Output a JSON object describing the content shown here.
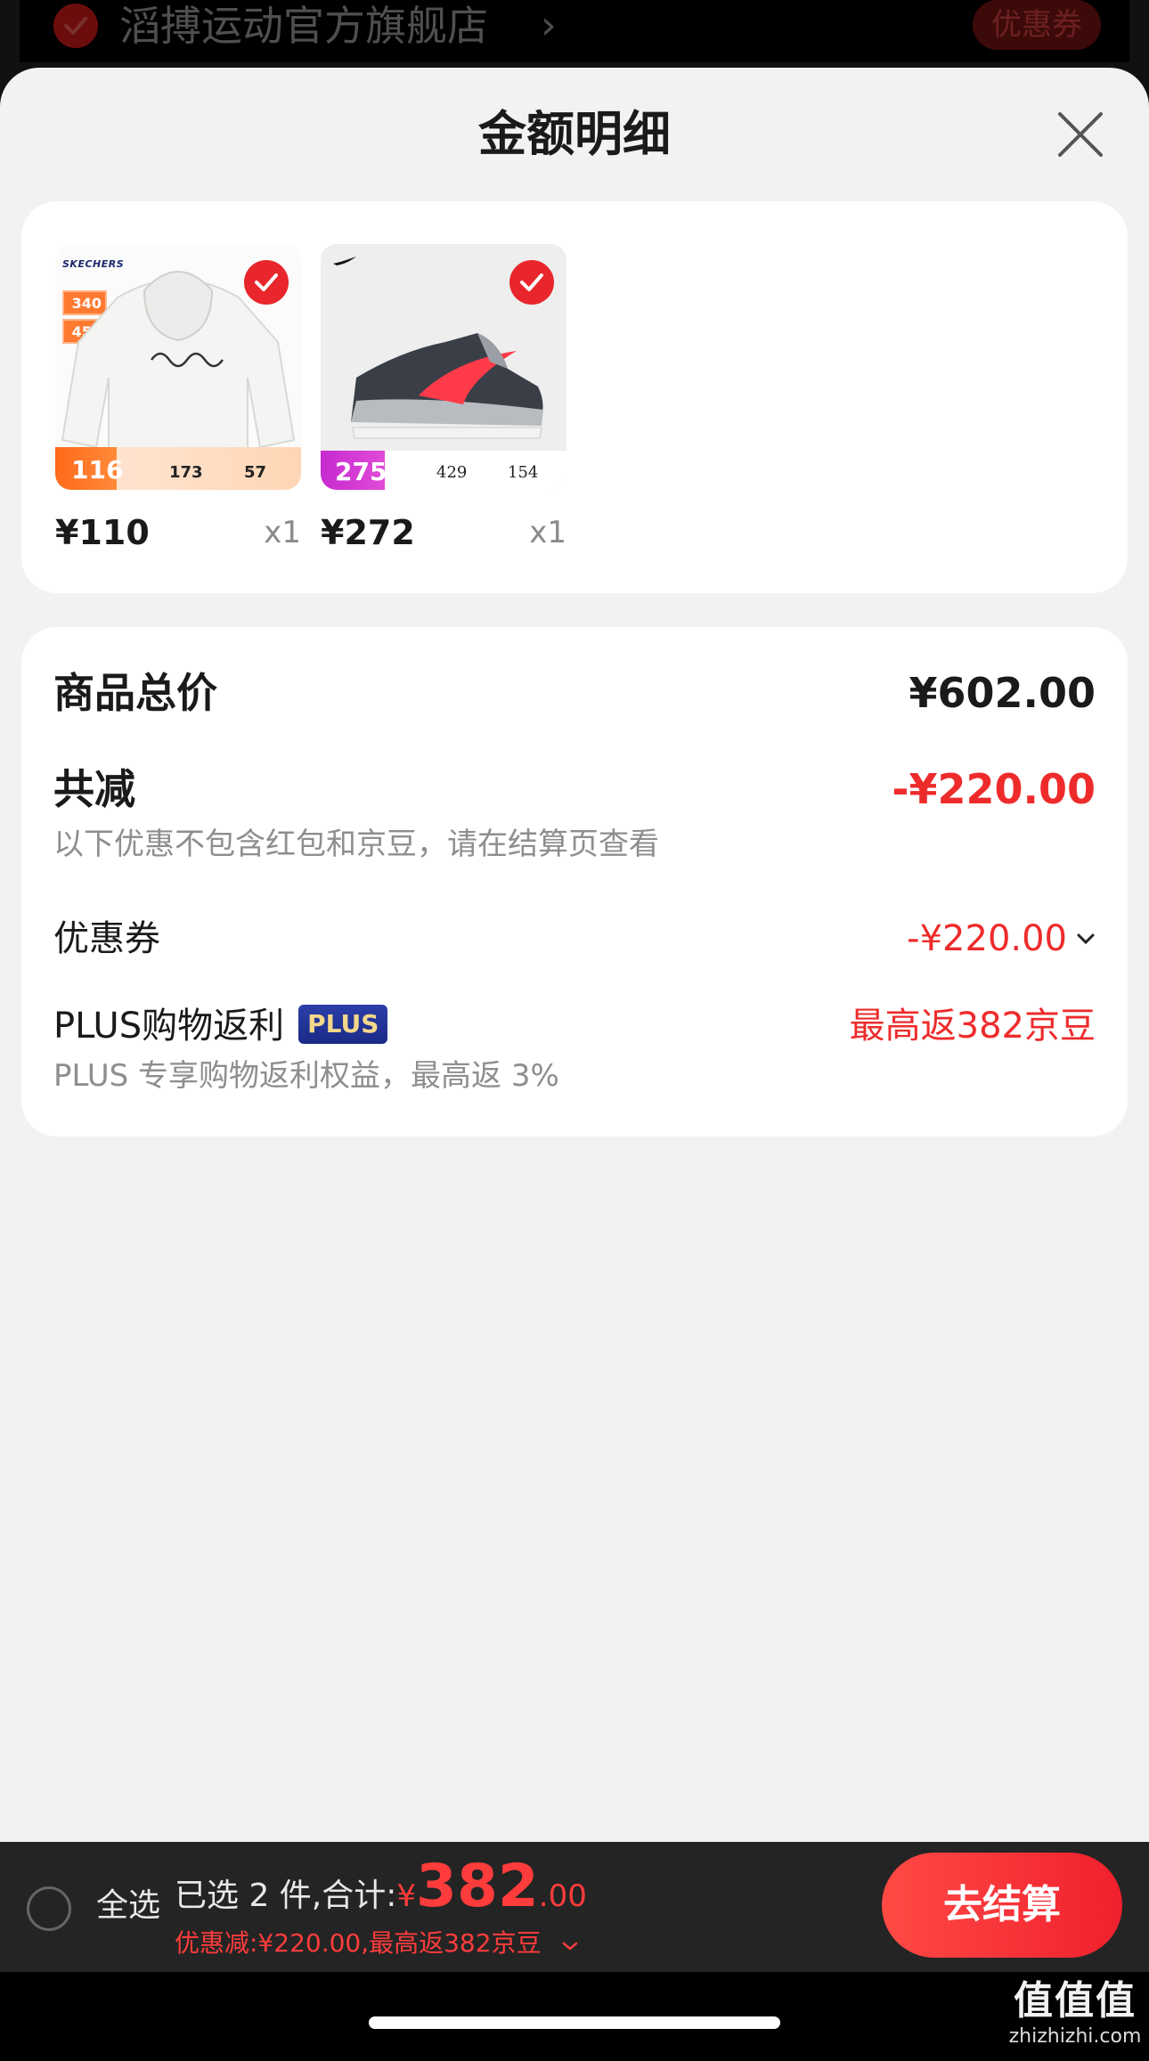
{
  "store": {
    "name": "滔搏运动官方旗舰店",
    "chevron": "›",
    "coupon_label": "优惠券"
  },
  "sheet": {
    "title": "金额明细"
  },
  "products": [
    {
      "brand": "SKECHERS",
      "tag_values": [
        "340",
        "450"
      ],
      "banner_price": "116",
      "banner_values": [
        "173",
        "57"
      ],
      "price": "¥110",
      "qty": "x1"
    },
    {
      "banner_price": "275",
      "banner_values": [
        "429",
        "154"
      ],
      "price": "¥272",
      "qty": "x1"
    }
  ],
  "summary": {
    "total_label": "商品总价",
    "total_value": "¥602.00",
    "reduce_label": "共减",
    "reduce_value": "-¥220.00",
    "reduce_note": "以下优惠不包含红包和京豆，请在结算页查看",
    "coupon_label": "优惠券",
    "coupon_value": "-¥220.00",
    "plus_label": "PLUS购物返利",
    "plus_badge": "PLUS",
    "plus_value": "最高返382京豆",
    "plus_note": "PLUS 专享购物返利权益，最高返 3%"
  },
  "bottom_bar": {
    "select_all": "全选",
    "selected_text": "已选 2 件,合计:",
    "currency": "¥",
    "total_int": "382",
    "total_dec": ".00",
    "discount_note": "优惠减:¥220.00,最高返382京豆",
    "checkout": "去结算"
  },
  "watermark": {
    "logo": "值值值",
    "url": "zhizhizhi.com"
  },
  "colors": {
    "accent_red": "#ee2b2b",
    "sheet_bg": "#f2f2f2",
    "bar_bg": "#242424"
  },
  "icons": {
    "close": "close-icon",
    "check": "check-icon",
    "chevron_down": "chevron-down-icon"
  }
}
